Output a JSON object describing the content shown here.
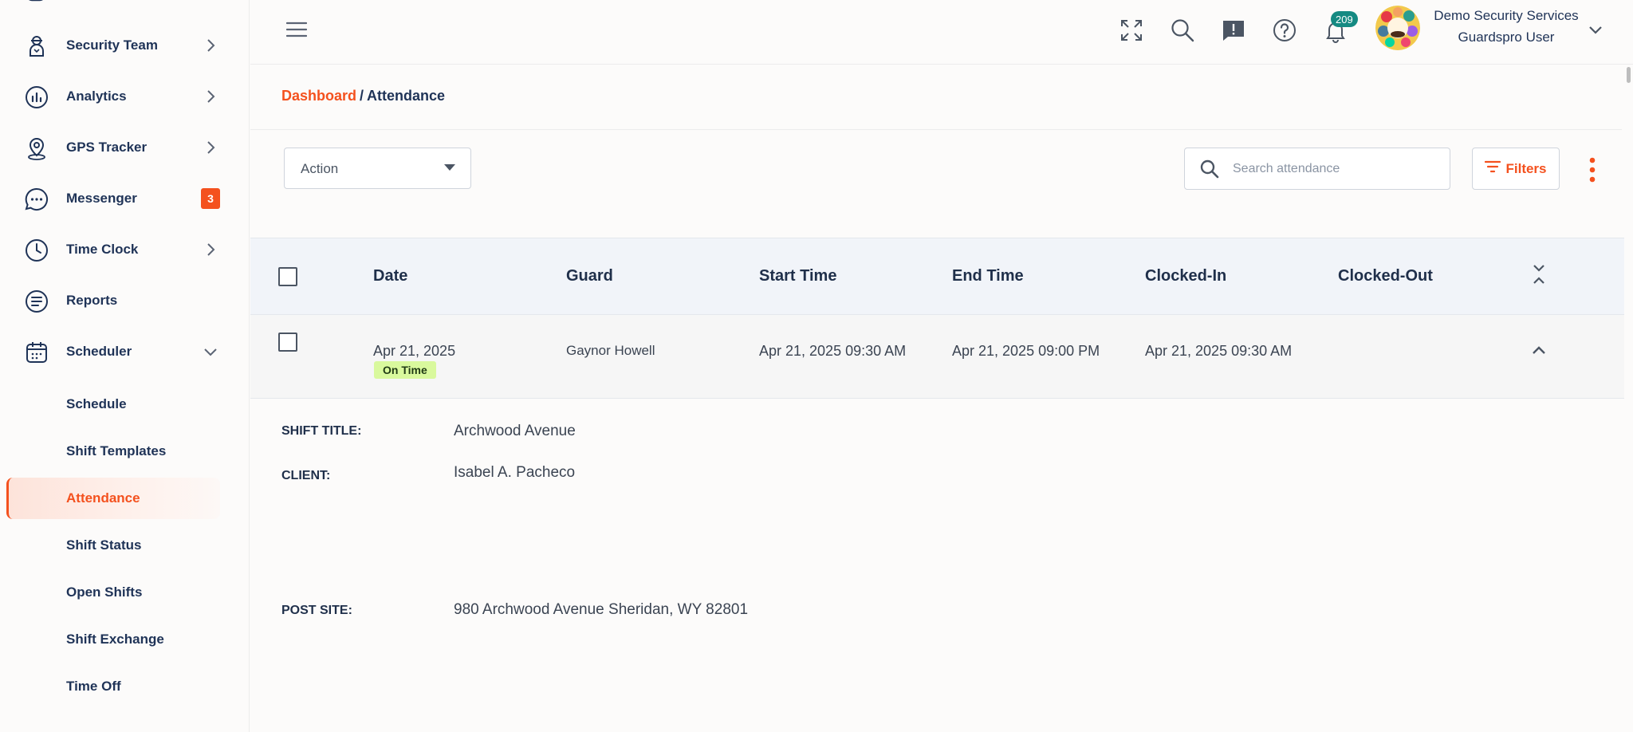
{
  "sidebar": {
    "items": [
      {
        "label": "Security Team",
        "icon": "guard-icon"
      },
      {
        "label": "Analytics",
        "icon": "analytics-icon"
      },
      {
        "label": "GPS Tracker",
        "icon": "map-pin-icon"
      },
      {
        "label": "Messenger",
        "icon": "chat-bubble-icon",
        "badge": "3"
      },
      {
        "label": "Time Clock",
        "icon": "clock-icon"
      },
      {
        "label": "Reports",
        "icon": "report-icon"
      },
      {
        "label": "Scheduler",
        "icon": "calendar-icon"
      }
    ],
    "scheduler_sub": [
      {
        "label": "Schedule"
      },
      {
        "label": "Shift Templates"
      },
      {
        "label": "Attendance"
      },
      {
        "label": "Shift Status"
      },
      {
        "label": "Open Shifts"
      },
      {
        "label": "Shift Exchange"
      },
      {
        "label": "Time Off"
      }
    ]
  },
  "header": {
    "notifications_count": "209",
    "user_name": "Demo Security Services",
    "user_role": "Guardspro User"
  },
  "breadcrumb": {
    "home": "Dashboard",
    "separator": "/",
    "current": "Attendance"
  },
  "toolbar": {
    "action_label": "Action",
    "search_placeholder": "Search attendance",
    "filters_label": "Filters"
  },
  "table": {
    "columns": [
      "Date",
      "Guard",
      "Start Time",
      "End Time",
      "Clocked-In",
      "Clocked-Out"
    ],
    "rows": [
      {
        "date": "Apr 21, 2025",
        "status": "On Time",
        "guard": "Gaynor Howell",
        "start_time": "Apr 21, 2025 09:30 AM",
        "end_time": "Apr 21, 2025 09:00 PM",
        "clocked_in": "Apr 21, 2025 09:30 AM",
        "clocked_out": ""
      }
    ]
  },
  "details": {
    "shift_title_label": "SHIFT TITLE:",
    "shift_title": "Archwood Avenue",
    "client_label": "CLIENT:",
    "client": "Isabel A. Pacheco",
    "post_site_label": "POST SITE:",
    "post_site": "980 Archwood Avenue Sheridan, WY 82801"
  },
  "colors": {
    "accent": "#f4511e",
    "nav_text": "#1f3357",
    "badge_teal": "#158a82",
    "status_green": "#d9f99d"
  }
}
